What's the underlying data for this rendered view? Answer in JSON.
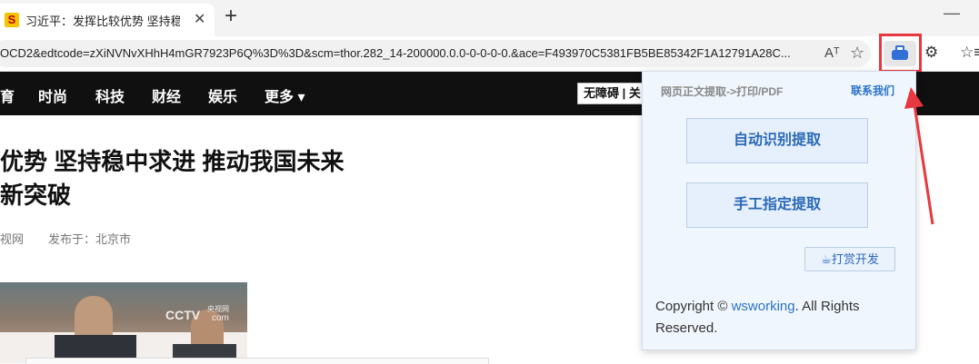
{
  "browser": {
    "tab_title": "习近平：发挥比较优势 坚持稳中求",
    "tab_favicon": "S",
    "new_tab": "+",
    "tab_close": "✕",
    "minimize": "—",
    "url": "OCD2&edtcode=zXiNVNvXHhH4mGR7923P6Q%3D%3D&scm=thor.282_14-200000.0.0-0-0-0-0.&ace=F493970C5381FB5BE85342F1A12791A28C..."
  },
  "icons": {
    "read_aloud": "Aᵀ",
    "favorite": "☆",
    "extensions": "⚙",
    "favorites_bar": "☆≡"
  },
  "site_nav": {
    "items": [
      "育",
      "时尚",
      "科技",
      "财经",
      "娱乐",
      "更多 ▾"
    ],
    "accessibility": "无障碍 | 关"
  },
  "article": {
    "headline_line1": "优势 坚持稳中求进 推动我国未来",
    "headline_line2": "新突破",
    "source": "视网",
    "published": "发布于：北京市",
    "image_watermark": "CCTV",
    "image_watermark_sub": "央视网",
    "image_watermark_com": "com"
  },
  "extension_popup": {
    "title": "网页正文提取->打印/PDF",
    "contact": "联系我们",
    "auto_button": "自动识别提取",
    "manual_button": "手工指定提取",
    "reward_button": "☕打赏开发",
    "copyright_prefix": "Copyright ©",
    "copyright_link": "wsworking",
    "copyright_suffix": ". All Rights Reserved."
  },
  "colors": {
    "highlight_red": "#e8383f",
    "extension_blue": "#2f6fd6",
    "popup_link": "#2a72c9"
  }
}
